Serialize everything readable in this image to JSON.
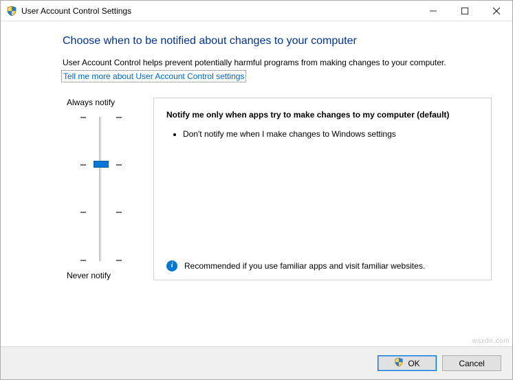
{
  "window": {
    "title": "User Account Control Settings"
  },
  "heading": "Choose when to be notified about changes to your computer",
  "description": "User Account Control helps prevent potentially harmful programs from making changes to your computer.",
  "help_link": "Tell me more about User Account Control settings",
  "slider": {
    "top_label": "Always notify",
    "bottom_label": "Never notify",
    "levels": 4,
    "current_level": 2
  },
  "panel": {
    "title": "Notify me only when apps try to make changes to my computer (default)",
    "bullets": [
      "Don't notify me when I make changes to Windows settings"
    ],
    "footer": "Recommended if you use familiar apps and visit familiar websites."
  },
  "buttons": {
    "ok": "OK",
    "cancel": "Cancel"
  },
  "watermark": "wsxdn.com"
}
